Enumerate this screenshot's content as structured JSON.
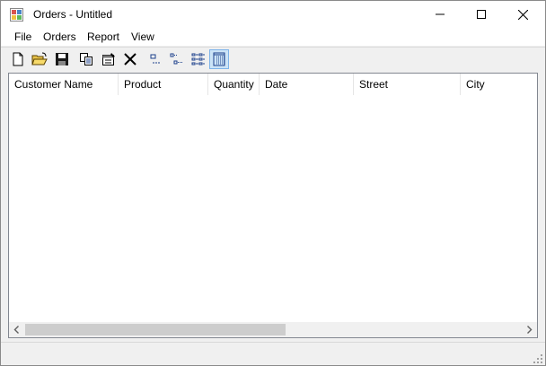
{
  "window": {
    "title": "Orders - Untitled"
  },
  "menu": [
    "File",
    "Orders",
    "Report",
    "View"
  ],
  "toolbar": {
    "buttons": [
      {
        "name": "new-icon"
      },
      {
        "name": "open-icon"
      },
      {
        "name": "save-icon"
      },
      {
        "name": "copy-icon"
      },
      {
        "name": "properties-icon"
      },
      {
        "name": "delete-icon"
      },
      {
        "name": "large-icons-view-icon"
      },
      {
        "name": "small-icons-view-icon"
      },
      {
        "name": "list-view-icon"
      },
      {
        "name": "details-view-icon"
      }
    ],
    "active": "details-view-icon"
  },
  "list": {
    "columns": [
      "Customer Name",
      "Product",
      "Quantity",
      "Date",
      "Street",
      "City"
    ],
    "rows": []
  },
  "colors": {
    "accent_active": "#cce4f7",
    "active_border": "#7eb4ea",
    "toolbar_blue": "#1b3f8b"
  }
}
